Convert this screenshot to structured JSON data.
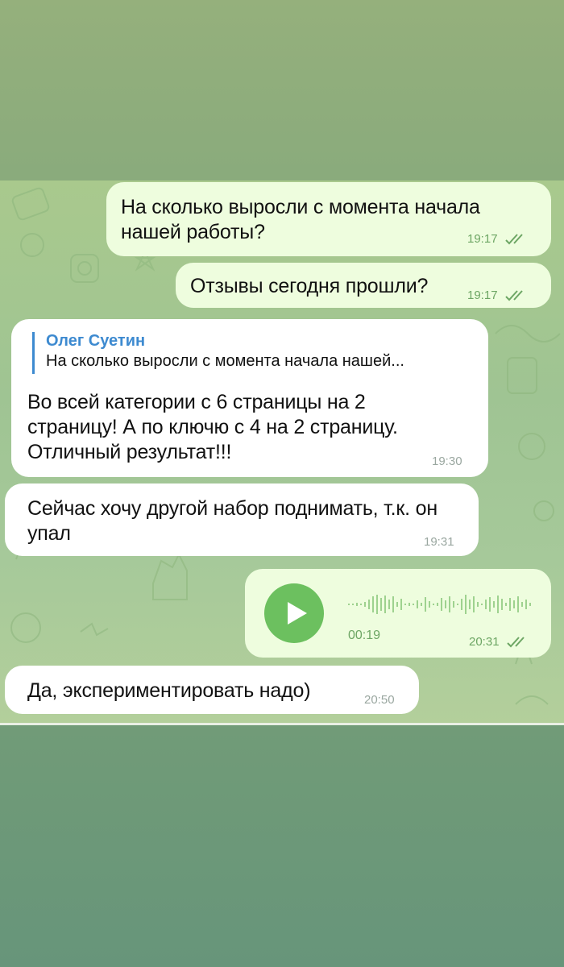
{
  "messages": [
    {
      "text": "На сколько выросли с момента начала нашей работы?",
      "time": "19:17"
    },
    {
      "text": "Отзывы сегодня прошли?",
      "time": "19:17"
    },
    {
      "reply": {
        "name": "Олег Суетин",
        "text": "На сколько выросли с момента начала нашей..."
      },
      "text": "Во всей категории с 6 страницы на 2 страницу! А по ключю с 4 на 2 страницу. Отличный результат!!!",
      "time": "19:30"
    },
    {
      "text": "Сейчас хочу другой набор поднимать, т.к. он упал",
      "time": "19:31"
    },
    {
      "duration": "00:19",
      "time": "20:31"
    },
    {
      "text": "Да, экспериментировать надо)",
      "time": "20:50"
    }
  ],
  "icons": {
    "play": "play-icon",
    "read": "double-check-icon",
    "waveform": "voice-waveform-icon"
  },
  "colors": {
    "outgoing_bubble": "#eefdde",
    "incoming_bubble": "#ffffff",
    "accent_green": "#6cc05f",
    "reply_name": "#3d8ad0"
  }
}
